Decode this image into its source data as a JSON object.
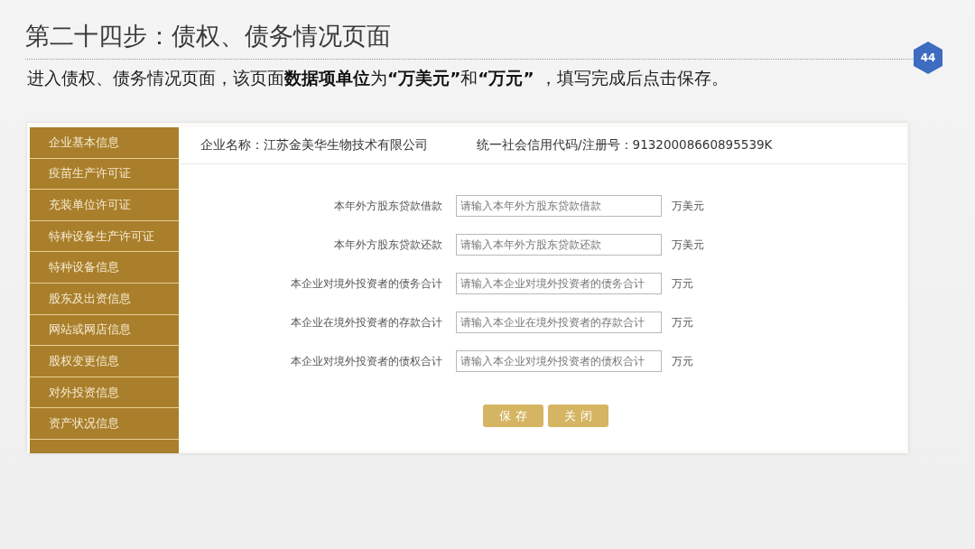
{
  "slide": {
    "title": "第二十四步：债权、债务情况页面",
    "page_number": "44",
    "instruction": "进入债权、债务情况页面，该页面**数据项单位**为**“万美元”**和**“万元”** ，填写完成后点击保存。"
  },
  "screenshot": {
    "sidebar": {
      "items": [
        {
          "label": "企业基本信息"
        },
        {
          "label": "疫苗生产许可证"
        },
        {
          "label": "充装单位许可证"
        },
        {
          "label": "特种设备生产许可证"
        },
        {
          "label": "特种设备信息"
        },
        {
          "label": "股东及出资信息"
        },
        {
          "label": "网站或网店信息"
        },
        {
          "label": "股权变更信息"
        },
        {
          "label": "对外投资信息"
        },
        {
          "label": "资产状况信息"
        }
      ]
    },
    "header": {
      "company_name": "企业名称：江苏金美华生物技术有限公司",
      "credit_code": "统一社会信用代码/注册号：91320008660895539K"
    },
    "fields": [
      {
        "label": "本年外方股东贷款借款",
        "placeholder": "请输入本年外方股东贷款借款",
        "unit": "万美元"
      },
      {
        "label": "本年外方股东贷款还款",
        "placeholder": "请输入本年外方股东贷款还款",
        "unit": "万美元"
      },
      {
        "label": "本企业对境外投资者的债务合计",
        "placeholder": "请输入本企业对境外投资者的债务合计",
        "unit": "万元"
      },
      {
        "label": "本企业在境外投资者的存款合计",
        "placeholder": "请输入本企业在境外投资者的存款合计",
        "unit": "万元"
      },
      {
        "label": "本企业对境外投资者的债权合计",
        "placeholder": "请输入本企业对境外投资者的债权合计",
        "unit": "万元"
      }
    ],
    "buttons": [
      "保存",
      "关闭"
    ]
  }
}
